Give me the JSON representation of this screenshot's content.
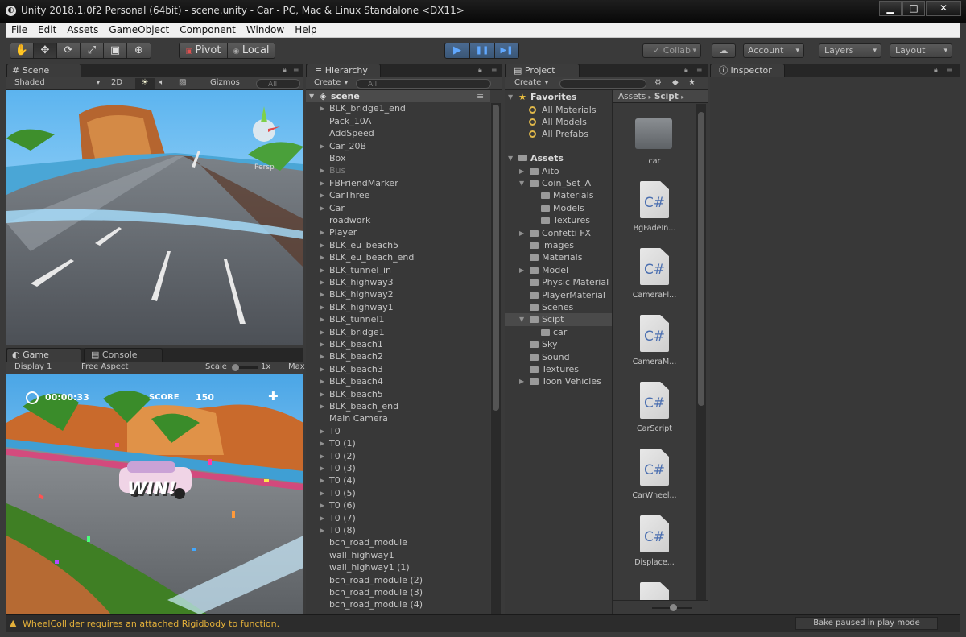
{
  "window": {
    "title": "Unity 2018.1.0f2 Personal (64bit) - scene.unity - Car - PC, Mac & Linux Standalone <DX11>",
    "minimize": "▁",
    "maximize": "□",
    "close": "✕"
  },
  "menu": [
    "File",
    "Edit",
    "Assets",
    "GameObject",
    "Component",
    "Window",
    "Help"
  ],
  "toolbar": {
    "pivot": "Pivot",
    "local": "Local",
    "collab": "Collab",
    "account": "Account",
    "layers": "Layers",
    "layout": "Layout",
    "play": "▶",
    "pause": "❚❚",
    "step": "▶❚"
  },
  "scene": {
    "tab": "Scene",
    "shading": "Shaded",
    "twod": "2D",
    "gizmos": "Gizmos",
    "search_placeholder": "All",
    "persp": "Persp"
  },
  "game": {
    "tab": "Game",
    "console_tab": "Console",
    "display": "Display 1",
    "aspect": "Free Aspect",
    "scale_label": "Scale",
    "scale_value": "1x",
    "maximize": "Max",
    "timer": "00:00:33",
    "score_label": "SCORE",
    "score": "150",
    "win": "WIN!"
  },
  "hierarchy": {
    "tab": "Hierarchy",
    "create": "Create",
    "search_placeholder": "All",
    "scene_name": "scene",
    "items": [
      {
        "name": "BLK_bridge1_end",
        "arrow": true,
        "dim": false
      },
      {
        "name": "Pack_10A",
        "arrow": false,
        "dim": false
      },
      {
        "name": "AddSpeed",
        "arrow": false,
        "dim": false
      },
      {
        "name": "Car_20B",
        "arrow": true,
        "dim": false
      },
      {
        "name": "Box",
        "arrow": false,
        "dim": false
      },
      {
        "name": "Bus",
        "arrow": true,
        "dim": true
      },
      {
        "name": "FBFriendMarker",
        "arrow": true,
        "dim": false
      },
      {
        "name": "CarThree",
        "arrow": true,
        "dim": false
      },
      {
        "name": "Car",
        "arrow": true,
        "dim": false
      },
      {
        "name": "roadwork",
        "arrow": false,
        "dim": false
      },
      {
        "name": "Player",
        "arrow": true,
        "dim": false
      },
      {
        "name": "BLK_eu_beach5",
        "arrow": true,
        "dim": false
      },
      {
        "name": "BLK_eu_beach_end",
        "arrow": true,
        "dim": false
      },
      {
        "name": "BLK_tunnel_in",
        "arrow": true,
        "dim": false
      },
      {
        "name": "BLK_highway3",
        "arrow": true,
        "dim": false
      },
      {
        "name": "BLK_highway2",
        "arrow": true,
        "dim": false
      },
      {
        "name": "BLK_highway1",
        "arrow": true,
        "dim": false
      },
      {
        "name": "BLK_tunnel1",
        "arrow": true,
        "dim": false
      },
      {
        "name": "BLK_bridge1",
        "arrow": true,
        "dim": false
      },
      {
        "name": "BLK_beach1",
        "arrow": true,
        "dim": false
      },
      {
        "name": "BLK_beach2",
        "arrow": true,
        "dim": false
      },
      {
        "name": "BLK_beach3",
        "arrow": true,
        "dim": false
      },
      {
        "name": "BLK_beach4",
        "arrow": true,
        "dim": false
      },
      {
        "name": "BLK_beach5",
        "arrow": true,
        "dim": false
      },
      {
        "name": "BLK_beach_end",
        "arrow": true,
        "dim": false
      },
      {
        "name": "Main Camera",
        "arrow": false,
        "dim": false
      },
      {
        "name": "T0",
        "arrow": true,
        "dim": false
      },
      {
        "name": "T0 (1)",
        "arrow": true,
        "dim": false
      },
      {
        "name": "T0 (2)",
        "arrow": true,
        "dim": false
      },
      {
        "name": "T0 (3)",
        "arrow": true,
        "dim": false
      },
      {
        "name": "T0 (4)",
        "arrow": true,
        "dim": false
      },
      {
        "name": "T0 (5)",
        "arrow": true,
        "dim": false
      },
      {
        "name": "T0 (6)",
        "arrow": true,
        "dim": false
      },
      {
        "name": "T0 (7)",
        "arrow": true,
        "dim": false
      },
      {
        "name": "T0 (8)",
        "arrow": true,
        "dim": false
      },
      {
        "name": "bch_road_module",
        "arrow": false,
        "dim": false
      },
      {
        "name": "wall_highway1",
        "arrow": false,
        "dim": false
      },
      {
        "name": "wall_highway1 (1)",
        "arrow": false,
        "dim": false
      },
      {
        "name": "bch_road_module (2)",
        "arrow": false,
        "dim": false
      },
      {
        "name": "bch_road_module (3)",
        "arrow": false,
        "dim": false
      },
      {
        "name": "bch_road_module (4)",
        "arrow": false,
        "dim": false
      }
    ]
  },
  "project": {
    "tab": "Project",
    "create": "Create",
    "favorites_label": "Favorites",
    "favorites": [
      "All Materials",
      "All Models",
      "All Prefabs"
    ],
    "assets_label": "Assets",
    "tree": [
      {
        "name": "Aito",
        "depth": 1,
        "arrow": "right",
        "selected": false
      },
      {
        "name": "Coin_Set_A",
        "depth": 1,
        "arrow": "down",
        "selected": false
      },
      {
        "name": "Materials",
        "depth": 2,
        "arrow": "none",
        "selected": false
      },
      {
        "name": "Models",
        "depth": 2,
        "arrow": "none",
        "selected": false
      },
      {
        "name": "Textures",
        "depth": 2,
        "arrow": "none",
        "selected": false
      },
      {
        "name": "Confetti FX",
        "depth": 1,
        "arrow": "right",
        "selected": false
      },
      {
        "name": "images",
        "depth": 1,
        "arrow": "none",
        "selected": false
      },
      {
        "name": "Materials",
        "depth": 1,
        "arrow": "none",
        "selected": false
      },
      {
        "name": "Model",
        "depth": 1,
        "arrow": "right",
        "selected": false
      },
      {
        "name": "Physic Material",
        "depth": 1,
        "arrow": "none",
        "selected": false
      },
      {
        "name": "PlayerMaterial",
        "depth": 1,
        "arrow": "none",
        "selected": false
      },
      {
        "name": "Scenes",
        "depth": 1,
        "arrow": "none",
        "selected": false
      },
      {
        "name": "Scipt",
        "depth": 1,
        "arrow": "down",
        "selected": true
      },
      {
        "name": "car",
        "depth": 2,
        "arrow": "none",
        "selected": false
      },
      {
        "name": "Sky",
        "depth": 1,
        "arrow": "none",
        "selected": false
      },
      {
        "name": "Sound",
        "depth": 1,
        "arrow": "none",
        "selected": false
      },
      {
        "name": "Textures",
        "depth": 1,
        "arrow": "none",
        "selected": false
      },
      {
        "name": "Toon Vehicles",
        "depth": 1,
        "arrow": "right",
        "selected": false
      }
    ],
    "breadcrumb_root": "Assets",
    "breadcrumb_sep": "▸",
    "breadcrumb_current": "Scipt",
    "files": [
      {
        "label": "car",
        "kind": "folder"
      },
      {
        "label": "BgFadeIn...",
        "kind": "cs"
      },
      {
        "label": "CameraFl...",
        "kind": "cs"
      },
      {
        "label": "CameraM...",
        "kind": "cs"
      },
      {
        "label": "CarScript",
        "kind": "cs"
      },
      {
        "label": "CarWheel...",
        "kind": "cs"
      },
      {
        "label": "Displace...",
        "kind": "cs"
      }
    ],
    "cs_glyph": "C#"
  },
  "inspector": {
    "tab": "Inspector"
  },
  "status": {
    "warning": "WheelCollider requires an attached Rigidbody to function.",
    "bake": "Bake paused in play mode"
  },
  "colors": {
    "accent": "#3e6f9f",
    "warning": "#e3b03a",
    "play_icon": "#5aa6ff"
  }
}
